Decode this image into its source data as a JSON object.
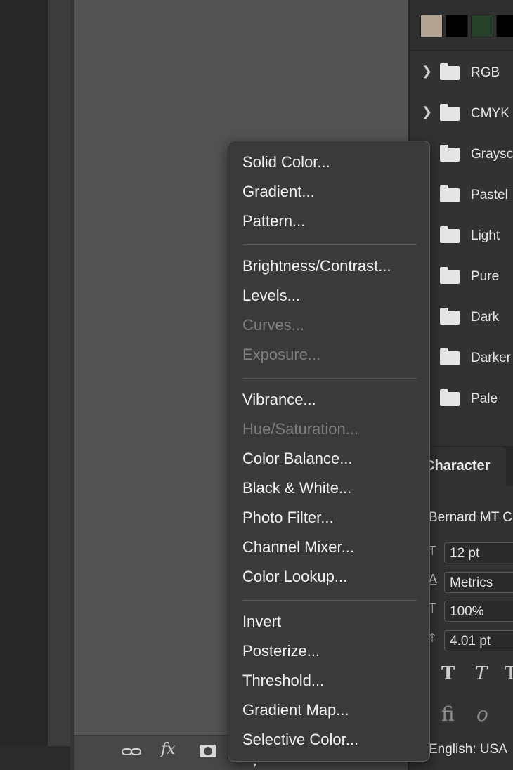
{
  "swatches": {
    "colors": [
      "#b3a393",
      "#000000",
      "#27402a",
      "#000000"
    ]
  },
  "swatch_groups": [
    {
      "label": "RGB",
      "expandable": true
    },
    {
      "label": "CMYK",
      "expandable": true
    },
    {
      "label": "Graysc",
      "expandable": false
    },
    {
      "label": "Pastel",
      "expandable": false
    },
    {
      "label": "Light",
      "expandable": false
    },
    {
      "label": "Pure",
      "expandable": false
    },
    {
      "label": "Dark",
      "expandable": false
    },
    {
      "label": "Darker",
      "expandable": false
    },
    {
      "label": "Pale",
      "expandable": false
    }
  ],
  "character": {
    "tab_label": "Character",
    "font_family": "Bernard MT C",
    "size": "12 pt",
    "kerning": "Metrics",
    "vertical_scale": "100%",
    "baseline_shift": "4.01 pt",
    "style_buttons": [
      "T",
      "T",
      "T"
    ],
    "opentype_buttons": [
      "fi",
      "o"
    ],
    "language": "English: USA"
  },
  "layers_bar": {
    "fx_label": "fx"
  },
  "adjustment_menu": {
    "groups": [
      [
        {
          "label": "Solid Color...",
          "enabled": true
        },
        {
          "label": "Gradient...",
          "enabled": true
        },
        {
          "label": "Pattern...",
          "enabled": true
        }
      ],
      [
        {
          "label": "Brightness/Contrast...",
          "enabled": true
        },
        {
          "label": "Levels...",
          "enabled": true
        },
        {
          "label": "Curves...",
          "enabled": false
        },
        {
          "label": "Exposure...",
          "enabled": false
        }
      ],
      [
        {
          "label": "Vibrance...",
          "enabled": true
        },
        {
          "label": "Hue/Saturation...",
          "enabled": false
        },
        {
          "label": "Color Balance...",
          "enabled": true
        },
        {
          "label": "Black & White...",
          "enabled": true
        },
        {
          "label": "Photo Filter...",
          "enabled": true
        },
        {
          "label": "Channel Mixer...",
          "enabled": true
        },
        {
          "label": "Color Lookup...",
          "enabled": true
        }
      ],
      [
        {
          "label": "Invert",
          "enabled": true
        },
        {
          "label": "Posterize...",
          "enabled": true
        },
        {
          "label": "Threshold...",
          "enabled": true
        },
        {
          "label": "Gradient Map...",
          "enabled": true
        },
        {
          "label": "Selective Color...",
          "enabled": true
        }
      ]
    ]
  }
}
